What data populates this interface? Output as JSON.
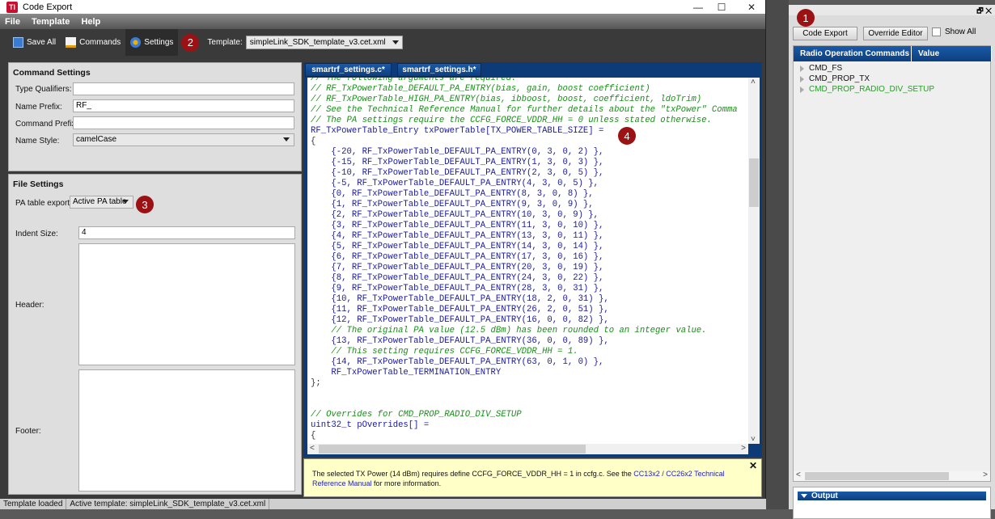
{
  "window": {
    "title": "Code Export",
    "logo": "TI",
    "minimize": "—",
    "maximize": "☐",
    "close": "✕"
  },
  "menu": [
    "File",
    "Template",
    "Help"
  ],
  "toolbar": {
    "save_all": "Save All",
    "commands": "Commands",
    "settings": "Settings",
    "template_label": "Template:",
    "template_value": "simpleLink_SDK_template_v3.cet.xml"
  },
  "badges": {
    "one": "1",
    "two": "2",
    "three": "3",
    "four": "4"
  },
  "command_settings": {
    "title": "Command Settings",
    "type_qualifiers_label": "Type Qualifiers:",
    "type_qualifiers_value": "",
    "name_prefix_label": "Name Prefix:",
    "name_prefix_value": "RF_",
    "command_prefix_label": "Command Prefix:",
    "command_prefix_value": "",
    "name_style_label": "Name Style:",
    "name_style_value": "camelCase"
  },
  "file_settings": {
    "title": "File Settings",
    "pa_table_label": "PA table export:",
    "pa_table_value": "Active PA table",
    "indent_label": "Indent Size:",
    "indent_value": "4",
    "header_label": "Header:",
    "footer_label": "Footer:"
  },
  "status": {
    "left": "Template loaded",
    "right": "Active template: simpleLink_SDK_template_v3.cet.xml"
  },
  "editor": {
    "tabs": [
      "smartrf_settings.c*",
      "smartrf_settings.h*"
    ],
    "lines": [
      {
        "t": "cm",
        "s": "// The following arguments are required:"
      },
      {
        "t": "cm",
        "s": "// RF_TxPowerTable_DEFAULT_PA_ENTRY(bias, gain, boost coefficient)"
      },
      {
        "t": "cm",
        "s": "// RF_TxPowerTable_HIGH_PA_ENTRY(bias, ibboost, boost, coefficient, ldoTrim)"
      },
      {
        "t": "cm",
        "s": "// See the Technical Reference Manual for further details about the \"txPower\" Comma"
      },
      {
        "t": "cm",
        "s": "// The PA settings require the CCFG_FORCE_VDDR_HH = 0 unless stated otherwise."
      },
      {
        "t": "kw",
        "s": "RF_TxPowerTable_Entry txPowerTable[TX_POWER_TABLE_SIZE] ="
      },
      {
        "t": "pl",
        "s": "{"
      },
      {
        "t": "kw",
        "s": "    {-20, RF_TxPowerTable_DEFAULT_PA_ENTRY(0, 3, 0, 2) },"
      },
      {
        "t": "kw",
        "s": "    {-15, RF_TxPowerTable_DEFAULT_PA_ENTRY(1, 3, 0, 3) },"
      },
      {
        "t": "kw",
        "s": "    {-10, RF_TxPowerTable_DEFAULT_PA_ENTRY(2, 3, 0, 5) },"
      },
      {
        "t": "kw",
        "s": "    {-5, RF_TxPowerTable_DEFAULT_PA_ENTRY(4, 3, 0, 5) },"
      },
      {
        "t": "kw",
        "s": "    {0, RF_TxPowerTable_DEFAULT_PA_ENTRY(8, 3, 0, 8) },"
      },
      {
        "t": "kw",
        "s": "    {1, RF_TxPowerTable_DEFAULT_PA_ENTRY(9, 3, 0, 9) },"
      },
      {
        "t": "kw",
        "s": "    {2, RF_TxPowerTable_DEFAULT_PA_ENTRY(10, 3, 0, 9) },"
      },
      {
        "t": "kw",
        "s": "    {3, RF_TxPowerTable_DEFAULT_PA_ENTRY(11, 3, 0, 10) },"
      },
      {
        "t": "kw",
        "s": "    {4, RF_TxPowerTable_DEFAULT_PA_ENTRY(13, 3, 0, 11) },"
      },
      {
        "t": "kw",
        "s": "    {5, RF_TxPowerTable_DEFAULT_PA_ENTRY(14, 3, 0, 14) },"
      },
      {
        "t": "kw",
        "s": "    {6, RF_TxPowerTable_DEFAULT_PA_ENTRY(17, 3, 0, 16) },"
      },
      {
        "t": "kw",
        "s": "    {7, RF_TxPowerTable_DEFAULT_PA_ENTRY(20, 3, 0, 19) },"
      },
      {
        "t": "kw",
        "s": "    {8, RF_TxPowerTable_DEFAULT_PA_ENTRY(24, 3, 0, 22) },"
      },
      {
        "t": "kw",
        "s": "    {9, RF_TxPowerTable_DEFAULT_PA_ENTRY(28, 3, 0, 31) },"
      },
      {
        "t": "kw",
        "s": "    {10, RF_TxPowerTable_DEFAULT_PA_ENTRY(18, 2, 0, 31) },"
      },
      {
        "t": "kw",
        "s": "    {11, RF_TxPowerTable_DEFAULT_PA_ENTRY(26, 2, 0, 51) },"
      },
      {
        "t": "kw",
        "s": "    {12, RF_TxPowerTable_DEFAULT_PA_ENTRY(16, 0, 0, 82) },"
      },
      {
        "t": "cm",
        "s": "    // The original PA value (12.5 dBm) has been rounded to an integer value."
      },
      {
        "t": "kw",
        "s": "    {13, RF_TxPowerTable_DEFAULT_PA_ENTRY(36, 0, 0, 89) },"
      },
      {
        "t": "cm",
        "s": "    // This setting requires CCFG_FORCE_VDDR_HH = 1."
      },
      {
        "t": "kw",
        "s": "    {14, RF_TxPowerTable_DEFAULT_PA_ENTRY(63, 0, 1, 0) },"
      },
      {
        "t": "kw",
        "s": "    RF_TxPowerTable_TERMINATION_ENTRY"
      },
      {
        "t": "pl",
        "s": "};"
      },
      {
        "t": "pl",
        "s": ""
      },
      {
        "t": "pl",
        "s": ""
      },
      {
        "t": "cm",
        "s": "// Overrides for CMD_PROP_RADIO_DIV_SETUP"
      },
      {
        "t": "kw",
        "s": "uint32_t pOverrides[] ="
      },
      {
        "t": "pl",
        "s": "{"
      }
    ]
  },
  "notice": {
    "text": "The selected TX Power (14 dBm) requires define CCFG_FORCE_VDDR_HH = 1 in ccfg.c. See the ",
    "link": "CC13x2 / CC26x2 Technical Reference Manual",
    "suffix": " for more information.",
    "close": "✕"
  },
  "right_panel": {
    "code_export": "Code Export",
    "override_editor": "Override Editor",
    "show_all": "Show All",
    "col_commands": "Radio Operation Commands",
    "col_value": "Value",
    "commands": [
      {
        "name": "CMD_FS",
        "color": "#111111"
      },
      {
        "name": "CMD_PROP_TX",
        "color": "#111111"
      },
      {
        "name": "CMD_PROP_RADIO_DIV_SETUP",
        "color": "#2a9a2a"
      }
    ],
    "output_title": "Output",
    "dock_icons": "🗗 ✕"
  }
}
